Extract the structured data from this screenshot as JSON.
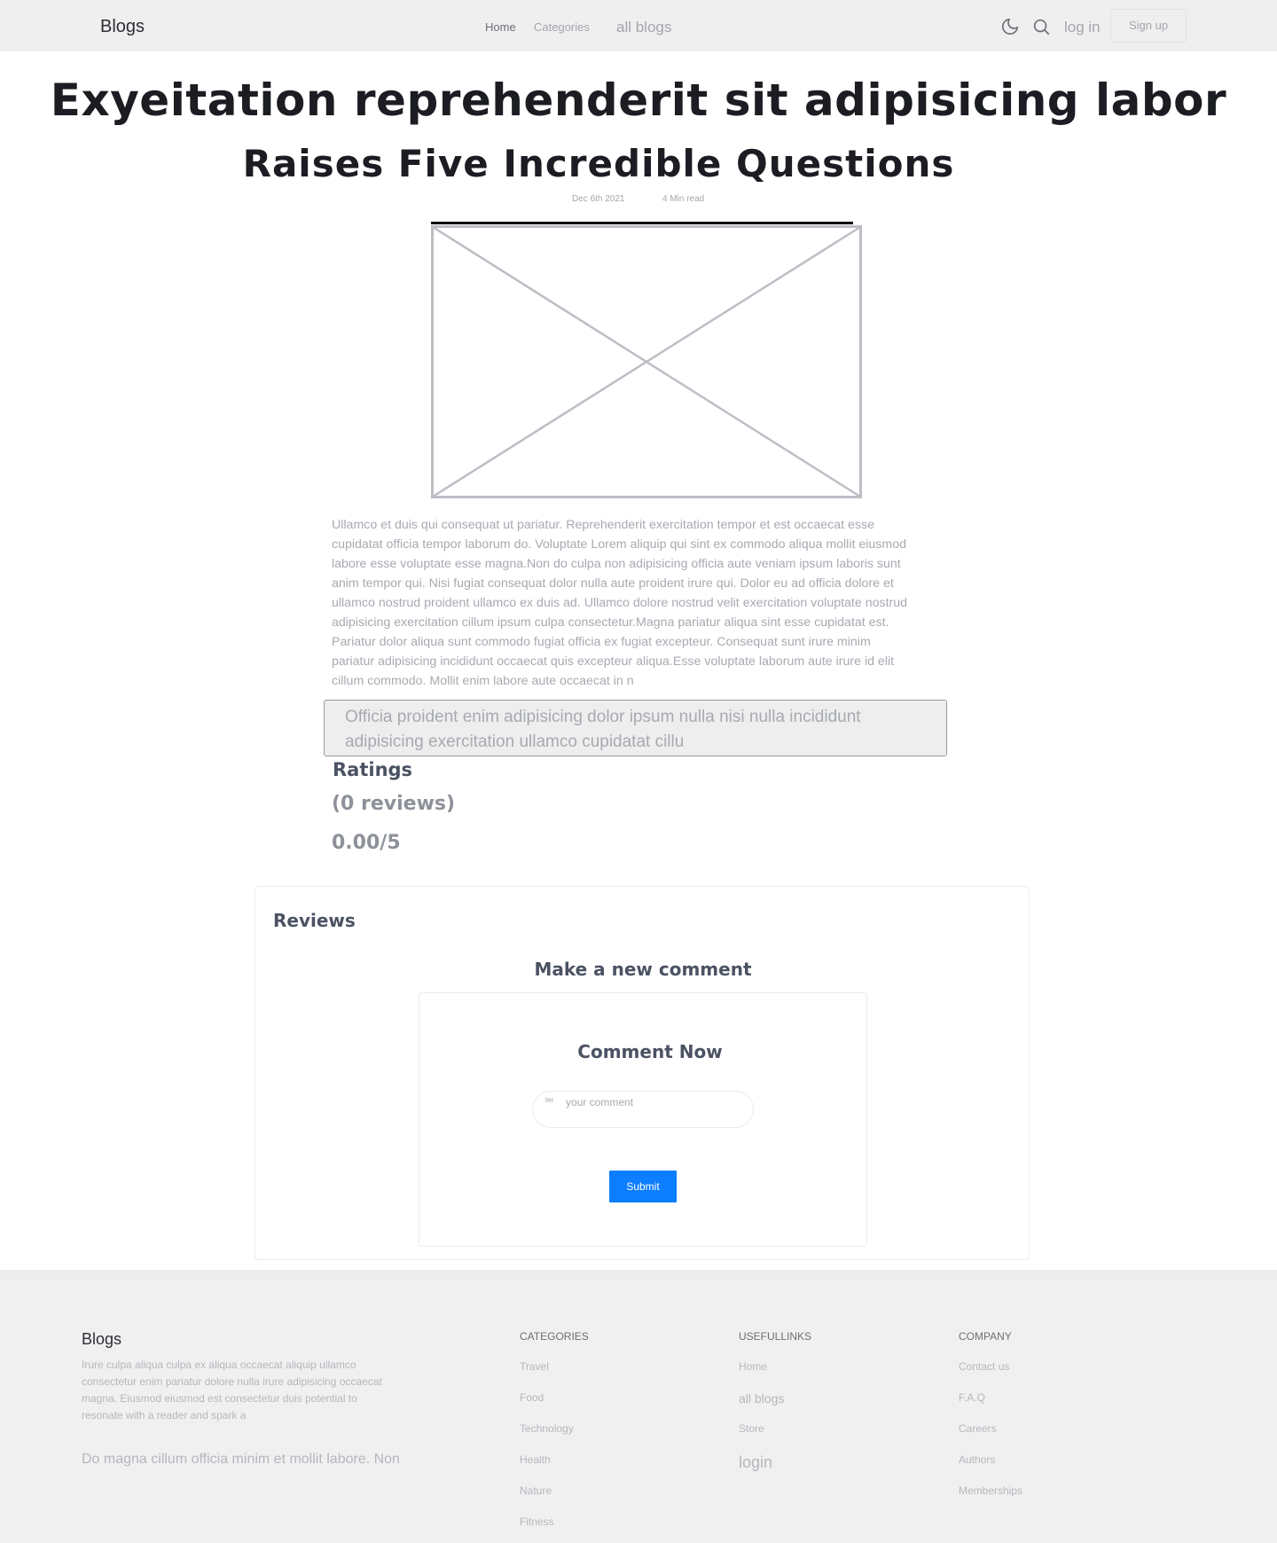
{
  "header": {
    "brand": "Blogs",
    "nav": {
      "home": "Home",
      "categories": "Categories",
      "all_blogs": "all blogs"
    },
    "icons": {
      "theme": "moon-icon",
      "search": "search-icon"
    },
    "login": "log in",
    "signup": "Sign up"
  },
  "article": {
    "title_line1": "Exyeitation reprehenderit sit adipisicing labor",
    "title_line2": "Raises Five Incredible Questions",
    "date": "Dec 6th 2021",
    "read_time": "4 Min read",
    "body": "Ullamco et duis qui consequat ut pariatur. Reprehenderit exercitation tempor et est occaecat esse cupidatat officia tempor laborum do. Voluptate Lorem aliquip qui sint ex commodo aliqua mollit eiusmod labore esse voluptate esse magna.Non do culpa non adipisicing officia aute veniam ipsum laboris sunt anim tempor qui. Nisi fugiat consequat dolor nulla aute proident irure qui. Dolor eu ad officia dolore et ullamco nostrud proident ullamco ex duis ad. Ullamco dolore nostrud velit exercitation voluptate nostrud adipisicing exercitation cillum ipsum culpa consectetur.Magna pariatur aliqua sint esse cupidatat est. Pariatur dolor aliqua sunt commodo fugiat officia ex fugiat excepteur. Consequat sunt irure minim pariatur adipisicing incididunt occaecat quis excepteur aliqua.Esse voluptate laborum aute irure id elit cillum commodo. Mollit enim labore aute occaecat in n",
    "quote": "Officia proident enim adipisicing dolor ipsum nulla nisi nulla incididunt adipisicing exercitation ullamco cupidatat cillu"
  },
  "ratings": {
    "label": "Ratings",
    "reviews_count": "(0 reviews)",
    "score": "0.00/5"
  },
  "reviews": {
    "title": "Reviews",
    "make_comment": "Make a new comment",
    "comment_now": "Comment Now",
    "input_tag": "ter",
    "input_placeholder": "your comment",
    "submit": "Submit",
    "submit_color": "#0d7eff"
  },
  "footer": {
    "brand": "Blogs",
    "description": "Irure culpa aliqua culpa ex aliqua occaecat aliquip ullamco consectetur enim pariatur dolore nulla irure adipisicing occaecat magna. Eiusmod eiusmod est consectetur duis potential to resonate with a reader and spark a",
    "quote": "Do magna cillum officia minim et mollit labore. Non",
    "categories": {
      "heading": "CATEGORIES",
      "items": [
        "Travel",
        "Food",
        "Technology",
        "Health",
        "Nature",
        "Fitness"
      ]
    },
    "useful_links": {
      "heading": "USEFULLINKS",
      "items": [
        "Home",
        "all blogs",
        "Store",
        "login"
      ]
    },
    "company": {
      "heading": "COMPANY",
      "items": [
        "Contact us",
        "F.A.Q",
        "Careers",
        "Authors",
        "Memberships"
      ]
    }
  }
}
